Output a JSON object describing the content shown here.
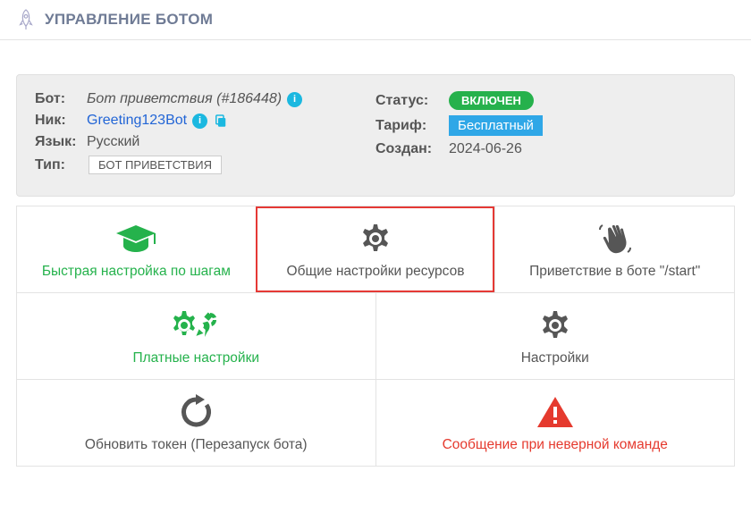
{
  "header": {
    "title": "УПРАВЛЕНИЕ БОТОМ"
  },
  "info": {
    "bot_label": "Бот:",
    "bot_value": "Бот приветствия (#186448)",
    "nick_label": "Ник:",
    "nick_value": "Greeting123Bot",
    "lang_label": "Язык:",
    "lang_value": "Русский",
    "type_label": "Тип:",
    "type_value": "БОТ ПРИВЕТСТВИЯ",
    "status_label": "Статус:",
    "status_value": "ВКЛЮЧЕН",
    "tariff_label": "Тариф:",
    "tariff_value": "Бесплатный",
    "created_label": "Создан:",
    "created_value": "2024-06-26",
    "info_glyph": "i"
  },
  "tiles": {
    "quick_setup": "Быстрая настройка по шагам",
    "common_settings": "Общие настройки ресурсов",
    "greeting_start": "Приветствие в боте \"/start\"",
    "paid_settings": "Платные настройки",
    "settings": "Настройки",
    "refresh_token": "Обновить токен (Перезапуск бота)",
    "invalid_command": "Сообщение при неверной команде"
  }
}
